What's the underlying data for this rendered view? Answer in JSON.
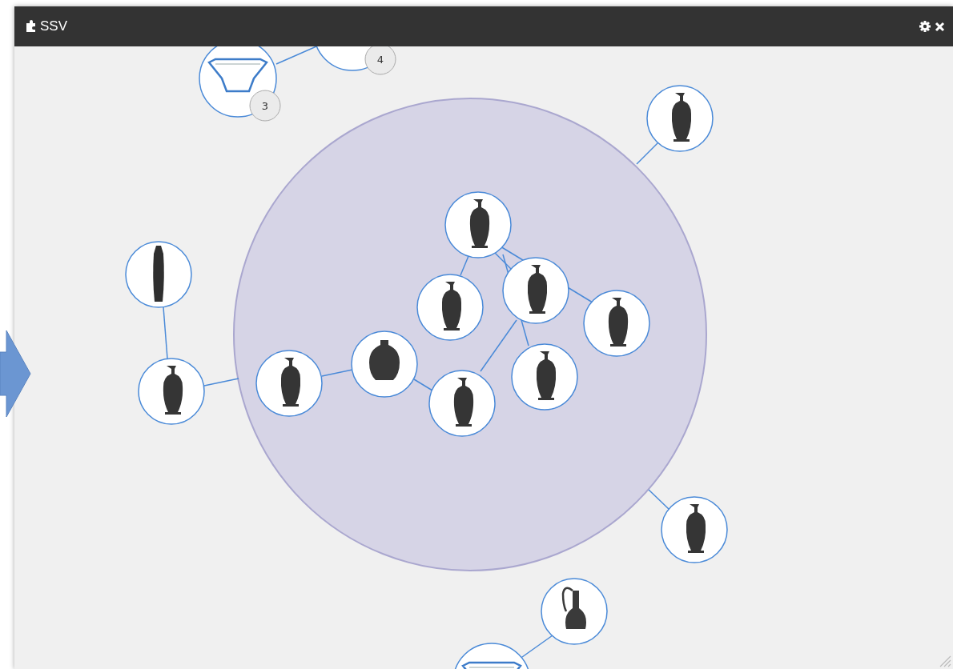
{
  "window": {
    "title": "SSV"
  },
  "graph": {
    "badges": [
      "3",
      "4"
    ]
  }
}
